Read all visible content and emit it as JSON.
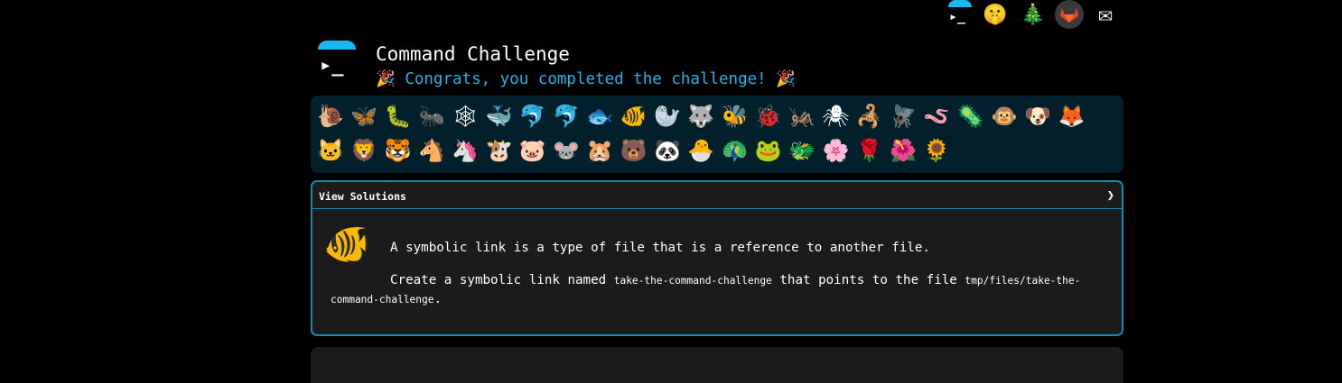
{
  "nav": {
    "icons": [
      {
        "name": "cmdchallenge-icon",
        "glyph": "▸_"
      },
      {
        "name": "shushing-face-icon",
        "glyph": "🤫"
      },
      {
        "name": "christmas-tree-icon",
        "glyph": "🎄"
      },
      {
        "name": "gitlab-icon",
        "glyph": ""
      },
      {
        "name": "envelope-icon",
        "glyph": "✉"
      }
    ],
    "prompt_glyph": "▸_"
  },
  "header": {
    "title": "Command Challenge",
    "congrats": "🎉 Congrats, you completed the challenge! 🎉"
  },
  "animals": [
    "🐌",
    "🦋",
    "🐛",
    "🐜",
    "🕸",
    "🐳",
    "🐬",
    "🐬",
    "🐟",
    "🐠",
    "🦭",
    "🐺",
    "🐝",
    "🐞",
    "🦗",
    "🕷",
    "🦂",
    "🪰",
    "🪱",
    "🦠",
    "🐵",
    "🐶",
    "🦊",
    "🐱",
    "🦁",
    "🐯",
    "🐴",
    "🦄",
    "🐮",
    "🐷",
    "🐭",
    "🐹",
    "🐻",
    "🐼",
    "🐣",
    "🦚",
    "🐸",
    "🐲",
    "🌸",
    "🌹",
    "🌺",
    "🌻"
  ],
  "solutions": {
    "header_label": "View Solutions",
    "chevron": "❯",
    "fish_glyph": "🐠",
    "line1": "A symbolic link is a type of file that is a reference to another file.",
    "line2_pre": "Create a symbolic link named ",
    "line2_code1": "take-the-command-challenge",
    "line2_mid": " that points to the file ",
    "line2_code2": "tmp/files/take-the-command-challenge",
    "line2_post": "."
  },
  "colors": {
    "accent": "#21b3e8",
    "panel": "#01202b",
    "card_border": "#1889aa",
    "card_bg": "#1b1b1b"
  }
}
